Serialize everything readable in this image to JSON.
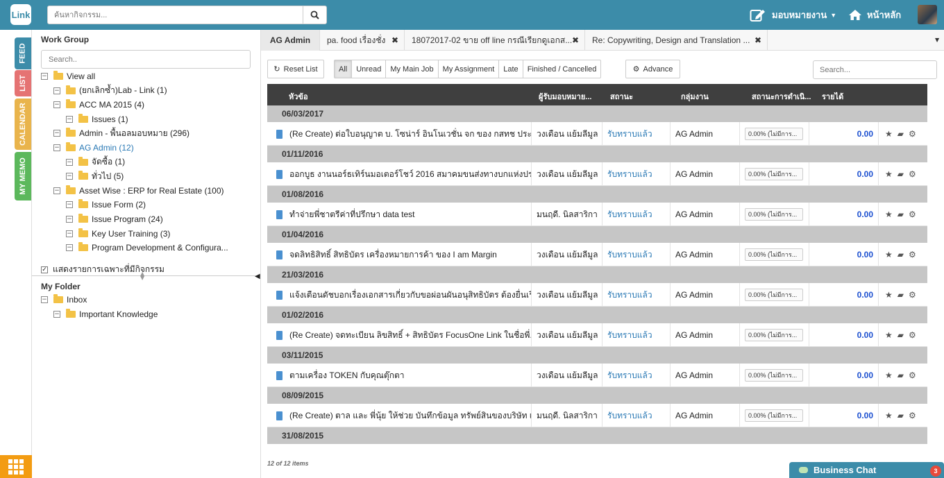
{
  "topbar": {
    "logo_text": "Link",
    "search_placeholder": "ค้นหากิจกรรม...",
    "assign_label": "มอบหมายงาน",
    "home_label": "หน้าหลัก"
  },
  "sidetabs": [
    {
      "label": "FEED",
      "color": "#3c8ca9"
    },
    {
      "label": "LIST",
      "color": "#e57373"
    },
    {
      "label": "CALENDAR",
      "color": "#e9b44c"
    },
    {
      "label": "MY MEMO",
      "color": "#5cb85c"
    }
  ],
  "workgroup": {
    "title": "Work Group",
    "search_placeholder": "Search..",
    "tree": [
      {
        "label": "View all",
        "level": 0
      },
      {
        "label": "(ยกเลิกซ้ำ)Lab - Link (1)",
        "level": 1
      },
      {
        "label": "ACC MA 2015 (4)",
        "level": 1
      },
      {
        "label": "Issues (1)",
        "level": 2
      },
      {
        "label": "Admin - พื้นอลมอบหมาย (296)",
        "level": 1
      },
      {
        "label": "AG Admin (12)",
        "level": 1,
        "active": true
      },
      {
        "label": "จัดซื้อ (1)",
        "level": 2
      },
      {
        "label": "ทั่วไป (5)",
        "level": 2
      },
      {
        "label": "Asset Wise : ERP for Real Estate (100)",
        "level": 1
      },
      {
        "label": "Issue Form (2)",
        "level": 2
      },
      {
        "label": "Issue Program (24)",
        "level": 2
      },
      {
        "label": "Key User Training (3)",
        "level": 2
      },
      {
        "label": "Program Development & Configura...",
        "level": 2
      }
    ],
    "filter_checkbox_label": "แสดงรายการเฉพาะที่มีกิจกรรม"
  },
  "myfolder": {
    "title": "My Folder",
    "tree": [
      {
        "label": "Inbox",
        "level": 0
      },
      {
        "label": "Important Knowledge",
        "level": 1
      }
    ]
  },
  "tabs": [
    {
      "label": "AG Admin",
      "active": true
    },
    {
      "label": "pa. food เรื่องชั่ง"
    },
    {
      "label": "18072017-02 ขาย off line กรณีเรียกดูเอกส..."
    },
    {
      "label": "Re: Copywriting, Design and Translation ..."
    }
  ],
  "toolbar": {
    "reset_label": "Reset List",
    "filters": [
      "All",
      "Unread",
      "My Main Job",
      "My Assignment",
      "Late",
      "Finished / Cancelled"
    ],
    "active_filter": "All",
    "advance_label": "Advance",
    "search_placeholder": "Search..."
  },
  "table": {
    "headers": {
      "subject": "หัวข้อ",
      "assigner": "ผู้รับมอบหมาย...",
      "status": "สถานะ",
      "group": "กลุ่มงาน",
      "progress": "สถานะการดำเนิ...",
      "income": "รายได้"
    },
    "groups": [
      {
        "date": "06/03/2017",
        "row": {
          "subject": "(Re Create) ต่อใบอนุญาต บ. โซน่าร์ อินโนเวชั่น จก ของ กสทช ประ...",
          "assigner": "วงเดือน แย้มลีมูล",
          "status": "รับทราบแล้ว",
          "group": "AG Admin",
          "progress": "0.00% (ไม่มีการ...",
          "income": "0.00"
        }
      },
      {
        "date": "01/11/2016",
        "row": {
          "subject": "ออกบูธ งานนอร์ธเทิร์นมอเตอร์โชว์ 2016 สมาคมขนส่งทางบกแห่งประ...",
          "assigner": "วงเดือน แย้มลีมูล",
          "status": "รับทราบแล้ว",
          "group": "AG Admin",
          "progress": "0.00% (ไม่มีการ...",
          "income": "0.00"
        }
      },
      {
        "date": "01/08/2016",
        "row": {
          "subject": "ทำจ่ายพี่ชาตรีค่าที่ปรึกษา data test",
          "assigner": "มนฤดี. นิลสาริกา",
          "status": "รับทราบแล้ว",
          "group": "AG Admin",
          "progress": "0.00% (ไม่มีการ...",
          "income": "0.00"
        }
      },
      {
        "date": "01/04/2016",
        "row": {
          "subject": "จดลิทธิสิทธิ์ สิทธิบัตร เครื่องหมายการค้า ของ I am Margin",
          "assigner": "วงเดือน แย้มลีมูล",
          "status": "รับทราบแล้ว",
          "group": "AG Admin",
          "progress": "0.00% (ไม่มีการ...",
          "income": "0.00"
        }
      },
      {
        "date": "21/03/2016",
        "row": {
          "subject": "แจ้งเตือนดัชบอกเรื่องเอกสารเกี่ยวกับขอผ่อนผันอนุสิทธิบัตร ต้องยื่นเรื่...",
          "assigner": "วงเดือน แย้มลีมูล",
          "status": "รับทราบแล้ว",
          "group": "AG Admin",
          "progress": "0.00% (ไม่มีการ...",
          "income": "0.00"
        }
      },
      {
        "date": "01/02/2016",
        "row": {
          "subject": "(Re Create) จดทะเบียน ลิขสิทธิ์ + สิทธิบัตร FocusOne Link ในชื่อพี่...",
          "assigner": "วงเดือน แย้มลีมูล",
          "status": "รับทราบแล้ว",
          "group": "AG Admin",
          "progress": "0.00% (ไม่มีการ...",
          "income": "0.00"
        }
      },
      {
        "date": "03/11/2015",
        "row": {
          "subject": "ตามเครื่อง TOKEN กับคุณตุ๊กตา",
          "assigner": "วงเดือน แย้มลีมูล",
          "status": "รับทราบแล้ว",
          "group": "AG Admin",
          "progress": "0.00% (ไม่มีการ...",
          "income": "0.00"
        }
      },
      {
        "date": "08/09/2015",
        "row": {
          "subject": "(Re Create) ตาล และ พี่นุ้ย ให้ช่วย บันทึกข้อมูล ทรัพย์สินของบริษัท เ...",
          "assigner": "มนฤดี. นิลสาริกา",
          "status": "รับทราบแล้ว",
          "group": "AG Admin",
          "progress": "0.00% (ไม่มีการ...",
          "income": "0.00"
        }
      },
      {
        "date": "31/08/2015",
        "row": null
      }
    ],
    "count_text": "12 of 12 items"
  },
  "chat": {
    "label": "Business Chat",
    "badge": "3"
  }
}
